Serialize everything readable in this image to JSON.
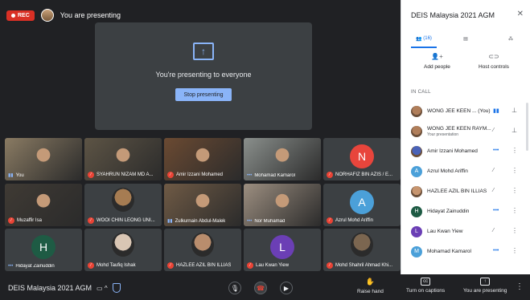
{
  "recording": {
    "label": "REC"
  },
  "top": {
    "status_text": "You are presenting"
  },
  "presenting_card": {
    "message": "You're presenting to everyone",
    "stop_label": "Stop presenting"
  },
  "tiles": [
    {
      "name": "You",
      "status": "mic-on",
      "kind": "video",
      "bg": "#8a7b63"
    },
    {
      "name": "SYAHRUN NIZAM MD A...",
      "status": "muted",
      "kind": "video",
      "bg": "#5d5445"
    },
    {
      "name": "Amir Izzani Mohamed",
      "status": "muted",
      "kind": "video",
      "bg": "#6b4a32"
    },
    {
      "name": "Mohamad Kamarol",
      "status": "dots",
      "kind": "video",
      "bg": "#8a8f8c"
    },
    {
      "name": "NORHAFIZ BIN AZIS / E...",
      "status": "muted",
      "kind": "letter",
      "letter": "N",
      "color": "#e8453c"
    },
    {
      "name": "Muzaffir Isa",
      "status": "muted",
      "kind": "video",
      "bg": "#3f3a34"
    },
    {
      "name": "WOOI CHIN LEONG UNI...",
      "status": "muted",
      "kind": "photo",
      "color": "#a67c52"
    },
    {
      "name": "Zulkurnain Abdul-Malek",
      "status": "mic-on",
      "kind": "video",
      "bg": "#6f5a45"
    },
    {
      "name": "Nor Muhamad",
      "status": "dots",
      "kind": "video",
      "bg": "#9c8e80"
    },
    {
      "name": "Azrul Mohd Ariffin",
      "status": "muted",
      "kind": "letter",
      "letter": "A",
      "color": "#4ba0d9"
    },
    {
      "name": "Hidayat Zainuddin",
      "status": "dots",
      "kind": "letter",
      "letter": "H",
      "color": "#1e5b44"
    },
    {
      "name": "Mohd Taufiq Ishak",
      "status": "muted",
      "kind": "photo",
      "color": "#d9c6b4"
    },
    {
      "name": "HAZLEE AZIL BIN ILLIAS",
      "status": "muted",
      "kind": "photo",
      "color": "#b98d6d"
    },
    {
      "name": "Lau Kwan Yiew",
      "status": "muted",
      "kind": "letter",
      "letter": "L",
      "color": "#6b3fb5"
    },
    {
      "name": "Mohd Shahril Ahmad Khi...",
      "status": "muted",
      "kind": "photo",
      "color": "#7b6650"
    }
  ],
  "bottom": {
    "meeting_title": "DEIS Malaysia 2021 AGM",
    "raise_hand": "Raise hand",
    "captions": "Turn on captions",
    "presenting": "You are presenting"
  },
  "panel": {
    "title": "DEIS Malaysia 2021 AGM",
    "people_count": "(16)",
    "add_people": "Add people",
    "host_controls": "Host controls",
    "in_call": "IN CALL",
    "participants": [
      {
        "name": "WONG JEE KEEN ... (You)",
        "sub": "",
        "avatar": "photo",
        "color": "#b07e5a",
        "icon1": "mic-on",
        "icon2": "pin"
      },
      {
        "name": "WONG JEE KEEN RAYM...",
        "sub": "Your presentation",
        "avatar": "photo",
        "color": "#b07e5a",
        "icon1": "muted-grey",
        "icon2": "pin"
      },
      {
        "name": "Amir Izzani Mohamed",
        "sub": "",
        "avatar": "photo",
        "color": "#4a63b8",
        "icon1": "dots",
        "icon2": "more"
      },
      {
        "name": "Azrul Mohd Ariffin",
        "sub": "",
        "avatar": "letter",
        "letter": "A",
        "color": "#4ba0d9",
        "icon1": "muted-grey",
        "icon2": "more"
      },
      {
        "name": "HAZLEE AZIL BIN ILLIAS",
        "sub": "",
        "avatar": "photo",
        "color": "#c7956f",
        "icon1": "muted-grey",
        "icon2": "more"
      },
      {
        "name": "Hidayat Zainuddin",
        "sub": "",
        "avatar": "letter",
        "letter": "H",
        "color": "#1e5b44",
        "icon1": "dots",
        "icon2": "more"
      },
      {
        "name": "Lau Kwan Yiew",
        "sub": "",
        "avatar": "letter",
        "letter": "L",
        "color": "#6b3fb5",
        "icon1": "muted-grey",
        "icon2": "more"
      },
      {
        "name": "Mohamad Kamarol",
        "sub": "",
        "avatar": "letter",
        "letter": "M",
        "color": "#4ba0d9",
        "icon1": "dots",
        "icon2": "more"
      }
    ]
  }
}
